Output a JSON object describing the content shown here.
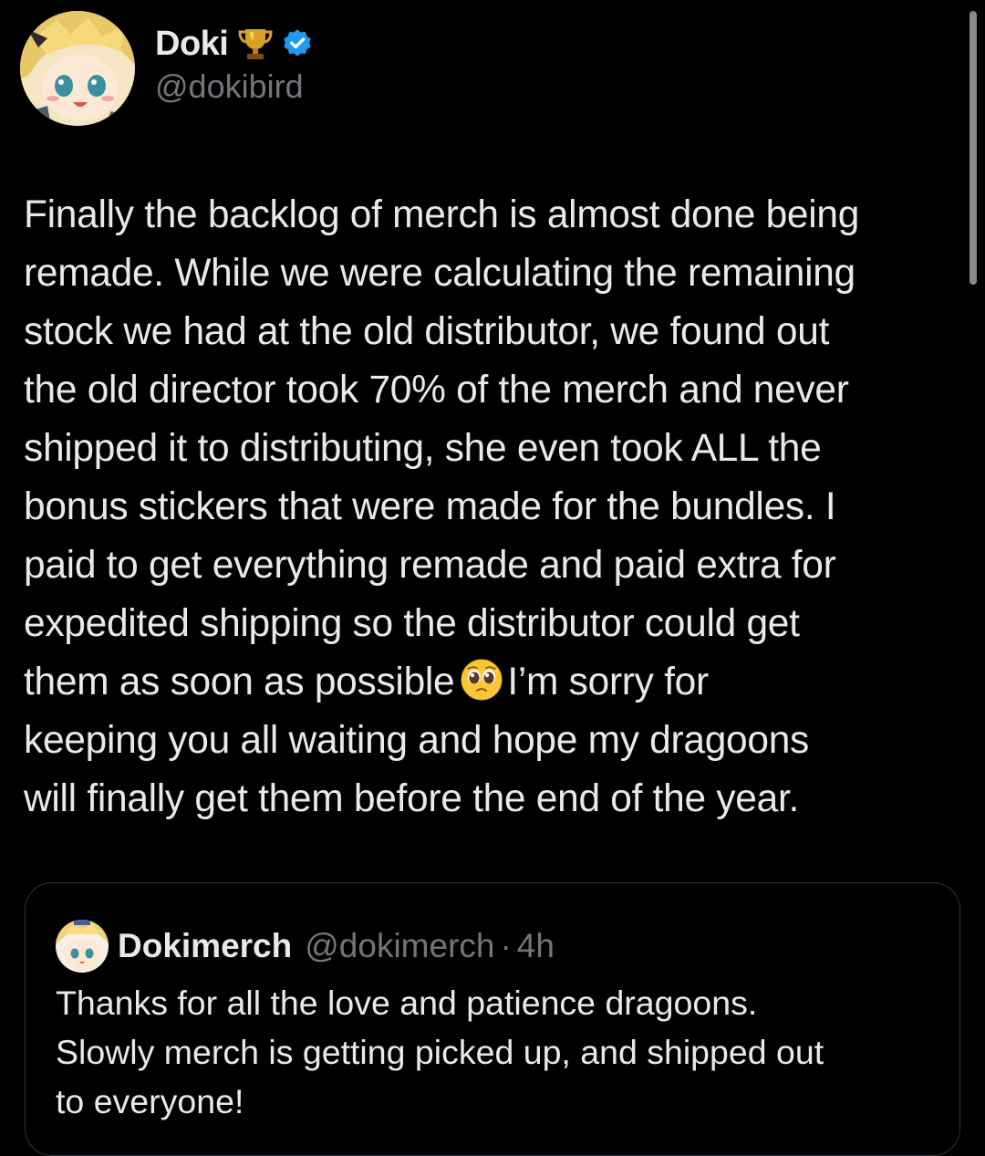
{
  "author": {
    "display_name": "Doki",
    "handle": "@dokibird",
    "badges": [
      "trophy-icon",
      "verified-icon"
    ],
    "verified_color": "#1d9bf0"
  },
  "tweet": {
    "lines": [
      "Finally the backlog of merch is almost done being",
      "remade. While we were calculating the remaining",
      "stock we had at the old distributor, we found out",
      "the old director took 70% of the merch and never",
      "shipped it to distributing, she even took ALL the",
      "bonus stickers that were made for the bundles. I",
      "paid to get everything remade and paid extra for",
      "expedited shipping so the distributor could get",
      "I’m sorry for",
      "keeping you all waiting and hope my dragoons",
      "will finally get them before the end of the year."
    ],
    "line9_before_emoji": "them as soon as possible",
    "emoji": "pleading-face-emoji"
  },
  "quote": {
    "display_name": "Dokimerch",
    "handle": "@dokimerch",
    "separator": "·",
    "time": "4h",
    "lines": [
      "Thanks for all the love and patience dragoons.",
      "Slowly merch is getting picked up, and shipped out",
      "to everyone!"
    ]
  },
  "colors": {
    "background": "#000000",
    "text": "#e7e9ea",
    "secondary_text": "#71767b",
    "border": "#2f3336"
  }
}
